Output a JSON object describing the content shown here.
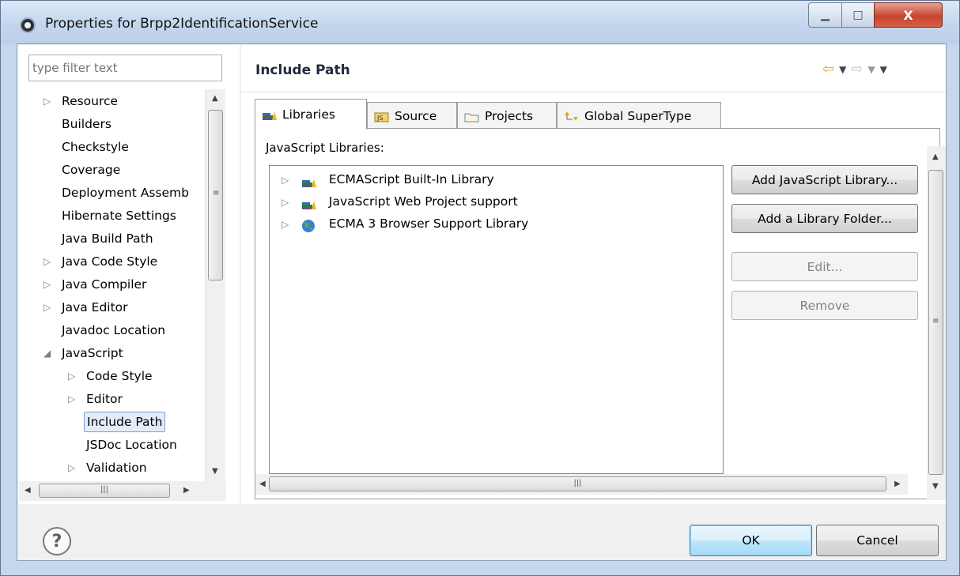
{
  "window": {
    "title": "Properties for Brpp2IdentificationService",
    "controls": {
      "minimize": "▁",
      "maximize": "□",
      "close": "X"
    }
  },
  "left": {
    "filter_placeholder": "type filter text",
    "tree": [
      {
        "label": "Resource",
        "expandable": true,
        "expanded": false,
        "indent": 0
      },
      {
        "label": "Builders",
        "expandable": false,
        "indent": 0
      },
      {
        "label": "Checkstyle",
        "expandable": false,
        "indent": 0
      },
      {
        "label": "Coverage",
        "expandable": false,
        "indent": 0
      },
      {
        "label": "Deployment Assemb",
        "expandable": false,
        "indent": 0
      },
      {
        "label": "Hibernate Settings",
        "expandable": false,
        "indent": 0
      },
      {
        "label": "Java Build Path",
        "expandable": false,
        "indent": 0
      },
      {
        "label": "Java Code Style",
        "expandable": true,
        "expanded": false,
        "indent": 0
      },
      {
        "label": "Java Compiler",
        "expandable": true,
        "expanded": false,
        "indent": 0
      },
      {
        "label": "Java Editor",
        "expandable": true,
        "expanded": false,
        "indent": 0
      },
      {
        "label": "Javadoc Location",
        "expandable": false,
        "indent": 0
      },
      {
        "label": "JavaScript",
        "expandable": true,
        "expanded": true,
        "indent": 0
      },
      {
        "label": "Code Style",
        "expandable": true,
        "expanded": false,
        "indent": 1
      },
      {
        "label": "Editor",
        "expandable": true,
        "expanded": false,
        "indent": 1
      },
      {
        "label": "Include Path",
        "expandable": false,
        "indent": 1,
        "selected": true
      },
      {
        "label": "JSDoc Location",
        "expandable": false,
        "indent": 1
      },
      {
        "label": "Validation",
        "expandable": true,
        "expanded": false,
        "indent": 1
      }
    ]
  },
  "main": {
    "title": "Include Path",
    "tabs": [
      {
        "label": "Libraries",
        "icon": "libraries-icon",
        "active": true
      },
      {
        "label": "Source",
        "icon": "source-folder-icon",
        "active": false
      },
      {
        "label": "Projects",
        "icon": "projects-folder-icon",
        "active": false
      },
      {
        "label": "Global SuperType",
        "icon": "global-supertype-icon",
        "active": false
      }
    ],
    "section_label": "JavaScript Libraries:",
    "libraries": [
      {
        "label": "ECMAScript Built-In Library",
        "icon": "library-icon"
      },
      {
        "label": "JavaScript Web Project support",
        "icon": "library-icon"
      },
      {
        "label": "ECMA 3 Browser Support Library",
        "icon": "globe-icon"
      }
    ],
    "buttons": {
      "add_js_library": "Add JavaScript Library...",
      "add_library_folder": "Add a Library Folder...",
      "edit": "Edit...",
      "remove": "Remove"
    }
  },
  "footer": {
    "help": "?",
    "ok": "OK",
    "cancel": "Cancel"
  },
  "colors": {
    "title_bar": "#c3d5ec",
    "close_button": "#c7442c",
    "selection_border": "#7da2ce",
    "nav_back": "#e3a91c"
  }
}
